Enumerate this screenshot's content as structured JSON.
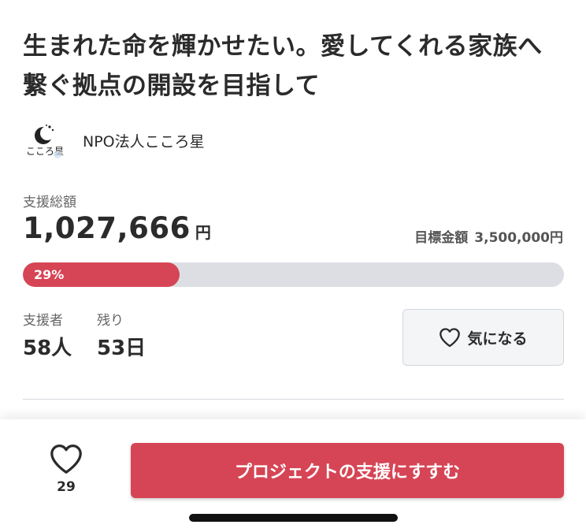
{
  "project": {
    "title": "生まれた命を輝かせたい。愛してくれる家族へ繋ぐ拠点の開設を目指して"
  },
  "organization": {
    "name": "NPO法人こころ星",
    "logo_text": "こころ星",
    "logo_icon": "moon-logo"
  },
  "funding": {
    "total_label": "支援総額",
    "total_value": "1,027,666",
    "total_unit": "円",
    "goal_label": "目標金額",
    "goal_value": "3,500,000円",
    "progress_text": "29%",
    "progress_fraction": 0.29
  },
  "stats": {
    "supporters_label": "支援者",
    "supporters_value": "58人",
    "remaining_label": "残り",
    "remaining_value": "53日"
  },
  "favorite_button": {
    "label": "気になる",
    "icon": "heart-icon"
  },
  "bottom_bar": {
    "like_count": "29",
    "like_icon": "heart-icon",
    "support_button_label": "プロジェクトの支援にすすむ"
  },
  "colors": {
    "accent": "#d64555",
    "track": "#dcdee3"
  }
}
